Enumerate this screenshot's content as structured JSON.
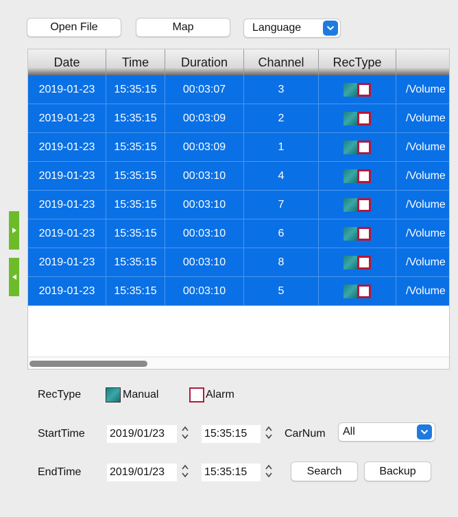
{
  "toolbar": {
    "open_file_label": "Open File",
    "map_label": "Map",
    "language_label": "Language"
  },
  "table": {
    "headers": [
      "Date",
      "Time",
      "Duration",
      "Channel",
      "RecType",
      ""
    ],
    "rows": [
      {
        "date": "2019-01-23",
        "time": "15:35:15",
        "duration": "00:03:07",
        "channel": "3",
        "path": "/Volume"
      },
      {
        "date": "2019-01-23",
        "time": "15:35:15",
        "duration": "00:03:09",
        "channel": "2",
        "path": "/Volume"
      },
      {
        "date": "2019-01-23",
        "time": "15:35:15",
        "duration": "00:03:09",
        "channel": "1",
        "path": "/Volume"
      },
      {
        "date": "2019-01-23",
        "time": "15:35:15",
        "duration": "00:03:10",
        "channel": "4",
        "path": "/Volume"
      },
      {
        "date": "2019-01-23",
        "time": "15:35:15",
        "duration": "00:03:10",
        "channel": "7",
        "path": "/Volume"
      },
      {
        "date": "2019-01-23",
        "time": "15:35:15",
        "duration": "00:03:10",
        "channel": "6",
        "path": "/Volume"
      },
      {
        "date": "2019-01-23",
        "time": "15:35:15",
        "duration": "00:03:10",
        "channel": "8",
        "path": "/Volume"
      },
      {
        "date": "2019-01-23",
        "time": "15:35:15",
        "duration": "00:03:10",
        "channel": "5",
        "path": "/Volume"
      }
    ]
  },
  "legend": {
    "rectype_label": "RecType",
    "manual_label": "Manual",
    "alarm_label": "Alarm"
  },
  "filters": {
    "start_time_label": "StartTime",
    "start_date": "2019/01/23",
    "start_clock": "15:35:15",
    "carnum_label": "CarNum",
    "carnum_value": "All",
    "end_time_label": "EndTime",
    "end_date": "2019/01/23",
    "end_clock": "15:35:15",
    "search_label": "Search",
    "backup_label": "Backup"
  },
  "colors": {
    "row_selected": "#0a70e6",
    "accent": "#1f7ae0",
    "side_tab": "#6cbc2a",
    "alarm_border": "#b01a3c",
    "manual_fill": "#2a9597"
  },
  "icons": {
    "language_dropdown": "chevron-down-icon",
    "carnum_dropdown": "chevron-down-icon",
    "side_tab_top": "triangle-right-icon",
    "side_tab_bottom": "triangle-left-icon",
    "stepper": "up-down-arrows-icon"
  }
}
